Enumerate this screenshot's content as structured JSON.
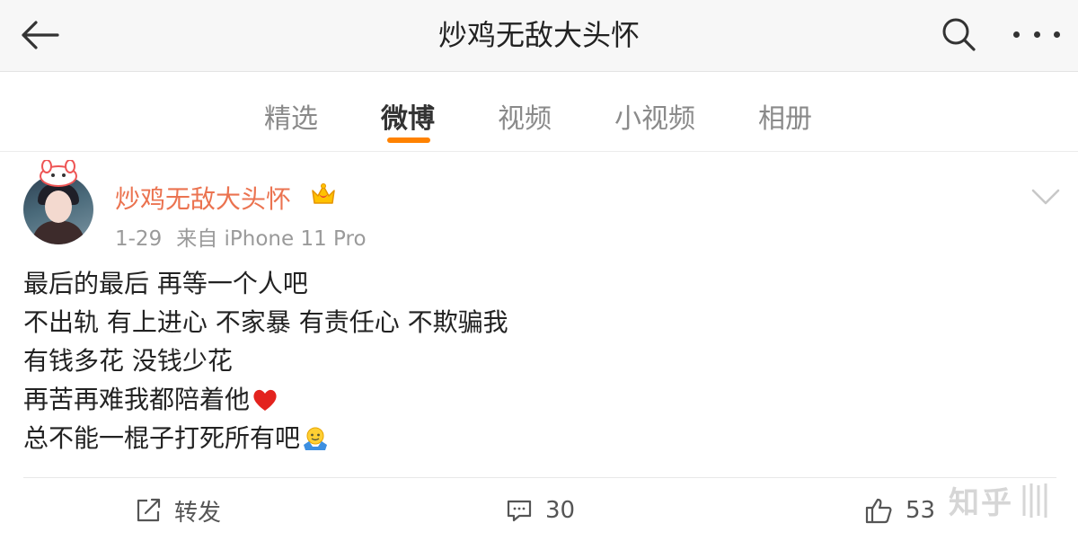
{
  "header": {
    "title": "炒鸡无敌大头怀",
    "back_icon": "back-arrow-icon",
    "search_icon": "search-icon",
    "more_icon": "more-dots-icon"
  },
  "tabs": [
    {
      "label": "精选",
      "active": false
    },
    {
      "label": "微博",
      "active": true
    },
    {
      "label": "视频",
      "active": false
    },
    {
      "label": "小视频",
      "active": false
    },
    {
      "label": "相册",
      "active": false
    }
  ],
  "colors": {
    "accent": "#ff8200",
    "username": "#eb7350",
    "meta": "#9a9a9a"
  },
  "post": {
    "username": "炒鸡无敌大头怀",
    "badge_icon": "vip-crown-icon",
    "date": "1-29",
    "source": "来自 iPhone 11 Pro",
    "lines": [
      "最后的最后 再等一个人吧",
      "不出轨 有上进心 不家暴 有责任心 不欺骗我",
      "有钱多花 没钱少花",
      "再苦再难我都陪着他",
      "总不能一棍子打死所有吧"
    ],
    "emojis": {
      "line4": "heart-emoji",
      "line5": "shrug-emoji"
    }
  },
  "actions": {
    "repost_label": "转发",
    "comment_count": "30",
    "like_count": "53"
  },
  "watermark": "知乎"
}
